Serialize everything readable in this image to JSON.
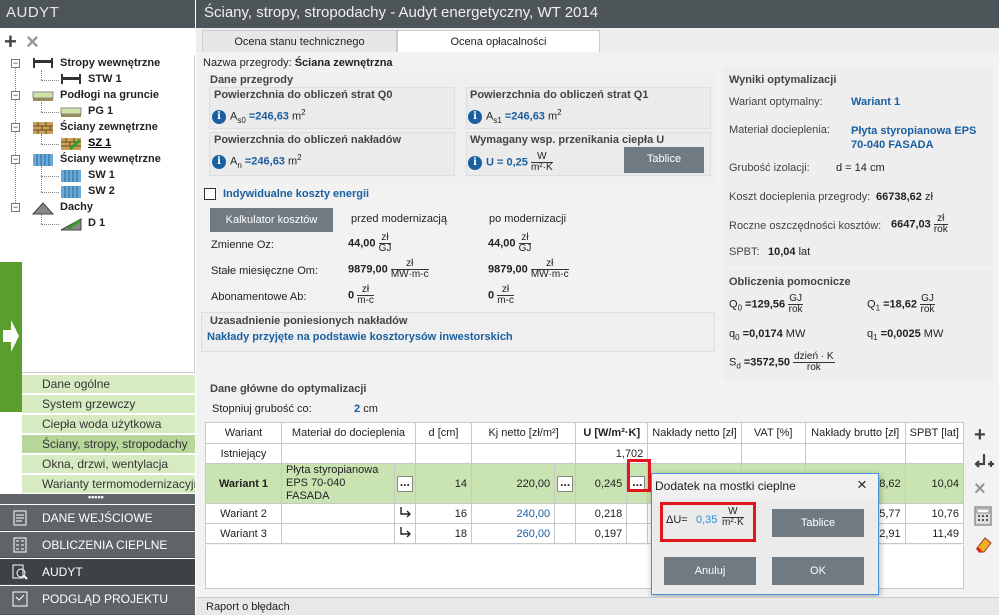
{
  "left_panel": {
    "title": "AUDYT",
    "tree": [
      {
        "label": "Stropy wewnętrzne",
        "child": "STW 1"
      },
      {
        "label": "Podłogi na gruncie",
        "child": "PG 1"
      },
      {
        "label": "Ściany zewnętrzne",
        "child": "SZ 1"
      },
      {
        "label": "Ściany wewnętrzne",
        "children": [
          "SW 1",
          "SW 2"
        ]
      },
      {
        "label": "Dachy",
        "child": "D 1"
      }
    ],
    "sections": [
      "Dane ogólne",
      "System grzewczy",
      "Ciepła woda użytkowa",
      "Ściany, stropy, stropodachy",
      "Okna, drzwi, wentylacja",
      "Warianty termomodernizacyjne"
    ],
    "nav": [
      "DANE WEJŚCIOWE",
      "OBLICZENIA CIEPLNE",
      "AUDYT",
      "PODGLĄD PROJEKTU"
    ]
  },
  "title": "Ściany, stropy, stropodachy - Audyt energetyczny, WT 2014",
  "tabs": [
    "Ocena stanu technicznego",
    "Ocena opłacalności"
  ],
  "nazwa": {
    "label": "Nazwa przegrody:",
    "value": "Ściana zewnętrzna"
  },
  "dane_przegrody": {
    "header": "Dane przegrody",
    "q0_label": "Powierzchnia do obliczeń strat Q0",
    "q0_sym": "A",
    "q0_sub": "s0",
    "q0_value": "=246,63",
    "q0_unit": "m",
    "q1_label": "Powierzchnia do obliczeń strat Q1",
    "q1_sym": "A",
    "q1_sub": "s1",
    "q1_value": "=246,63",
    "q1_unit": "m",
    "n_label": "Powierzchnia do obliczeń nakładów",
    "n_sym": "A",
    "n_sub": "n",
    "n_value": "=246,63",
    "n_unit": "m",
    "u_label": "Wymagany wsp. przenikania ciepła U",
    "u_value": "U = 0,25",
    "u_num": "W",
    "u_den": "m²·K",
    "tablice": "Tablice"
  },
  "koszty": {
    "checkbox": "Indywidualne koszty energii",
    "kalkulator": "Kalkulator kosztów",
    "przed": "przed modernizacją",
    "po": "po modernizacji",
    "rows": [
      {
        "label": "Zmienne Oz:",
        "przed": "44,00",
        "po": "44,00",
        "num": "zł",
        "den": "GJ"
      },
      {
        "label": "Stałe miesięczne Om:",
        "przed": "9879,00",
        "po": "9879,00",
        "num": "zł",
        "den": "MW·m-c"
      },
      {
        "label": "Abonamentowe Ab:",
        "przed": "0",
        "po": "0",
        "num": "zł",
        "den": "m-c"
      }
    ]
  },
  "uzasadnienie": {
    "header": "Uzasadnienie poniesionych nakładów",
    "text": "Nakłady przyjęte na podstawie kosztorysów inwestorskich"
  },
  "wyniki": {
    "header": "Wyniki optymalizacji",
    "wariant_label": "Wariant optymalny:",
    "wariant": "Wariant 1",
    "material_label": "Materiał docieplenia:",
    "material": "Płyta styropianowa EPS 70-040 FASADA",
    "grubosc_label": "Grubość izolacji:",
    "grubosc": "d = 14 cm",
    "koszt_label": "Koszt docieplenia przegrody:",
    "koszt": "66738,62",
    "koszt_unit": "zł",
    "oszcz_label": "Roczne oszczędności kosztów:",
    "oszcz": "6647,03",
    "oszcz_num": "zł",
    "oszcz_den": "rok",
    "spbt_label": "SPBT:",
    "spbt": "10,04",
    "spbt_unit": "lat"
  },
  "pomocnicze": {
    "header": "Obliczenia pomocnicze",
    "q0": "=129,56",
    "q0_num": "GJ",
    "q0_den": "rok",
    "q1": "=18,62",
    "q1_num": "GJ",
    "q1_den": "rok",
    "qs0": "=0,0174",
    "qs0_unit": "MW",
    "qs1": "=0,0025",
    "qs1_unit": "MW",
    "sd": "=3572,50",
    "sd_num": "dzień · K",
    "sd_den": "rok"
  },
  "optymalizacja": {
    "header": "Dane główne do optymalizacji",
    "stopniuj_label": "Stopniuj grubość co:",
    "stopniuj_value": "2",
    "stopniuj_unit": "cm"
  },
  "table": {
    "headers": [
      "Wariant",
      "Materiał do docieplenia",
      "d [cm]",
      "Kj netto [zł/m²]",
      "U [W/m²·K]",
      "Nakłady netto [zł]",
      "VAT [%]",
      "Nakłady brutto [zł]",
      "SPBT [lat]"
    ],
    "rows": [
      {
        "wariant": "Istniejący",
        "material": "",
        "d": "",
        "kj": "",
        "u": "1,702",
        "nett": "",
        "vat": "",
        "brutto": "",
        "spbt": ""
      },
      {
        "wariant": "Wariant 1",
        "material": "Płyta styropianowa EPS 70-040 FASADA",
        "d": "14",
        "kj": "220,00",
        "u": "0,245",
        "nett": "",
        "vat": "",
        "brutto": "8,62",
        "spbt": "10,04"
      },
      {
        "wariant": "Wariant 2",
        "material": "",
        "d": "16",
        "kj": "240,00",
        "u": "0,218",
        "nett": "",
        "vat": "",
        "brutto": "95,77",
        "spbt": "10,76"
      },
      {
        "wariant": "Wariant 3",
        "material": "",
        "d": "18",
        "kj": "260,00",
        "u": "0,197",
        "nett": "",
        "vat": "",
        "brutto": "72,91",
        "spbt": "11,49"
      }
    ],
    "dots": "..."
  },
  "dialog": {
    "title": "Dodatek na mostki cieplne",
    "du_label": "ΔU=",
    "du_value": "0,35",
    "du_num": "W",
    "du_den": "m²·K",
    "tablice": "Tablice",
    "cancel": "Anuluj",
    "ok": "OK"
  },
  "status": "Raport o błędach"
}
